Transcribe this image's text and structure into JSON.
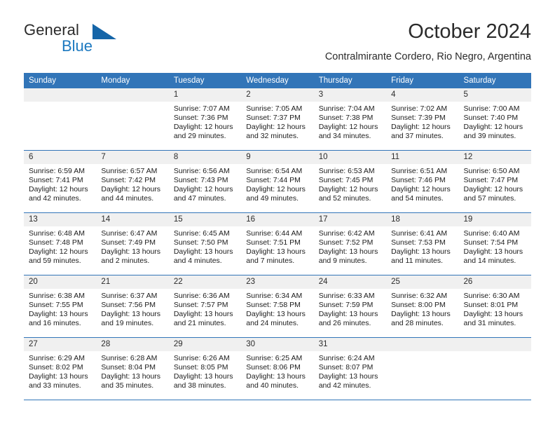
{
  "brand": {
    "name_part1": "General",
    "name_part2": "Blue",
    "logo_icon": "blue-triangle-icon"
  },
  "header": {
    "month_title": "October 2024",
    "location": "Contralmirante Cordero, Rio Negro, Argentina"
  },
  "theme": {
    "accent": "#3275b8",
    "brand_blue": "#1c79c0",
    "daynum_bg": "#f0f0f0",
    "text": "#1c1c1c"
  },
  "weekday_headers": [
    "Sunday",
    "Monday",
    "Tuesday",
    "Wednesday",
    "Thursday",
    "Friday",
    "Saturday"
  ],
  "weeks": [
    [
      {
        "day": "",
        "sunrise": "",
        "sunset": "",
        "daylight1": "",
        "daylight2": "",
        "blank": true
      },
      {
        "day": "",
        "sunrise": "",
        "sunset": "",
        "daylight1": "",
        "daylight2": "",
        "blank": true
      },
      {
        "day": "1",
        "sunrise": "Sunrise: 7:07 AM",
        "sunset": "Sunset: 7:36 PM",
        "daylight1": "Daylight: 12 hours",
        "daylight2": "and 29 minutes."
      },
      {
        "day": "2",
        "sunrise": "Sunrise: 7:05 AM",
        "sunset": "Sunset: 7:37 PM",
        "daylight1": "Daylight: 12 hours",
        "daylight2": "and 32 minutes."
      },
      {
        "day": "3",
        "sunrise": "Sunrise: 7:04 AM",
        "sunset": "Sunset: 7:38 PM",
        "daylight1": "Daylight: 12 hours",
        "daylight2": "and 34 minutes."
      },
      {
        "day": "4",
        "sunrise": "Sunrise: 7:02 AM",
        "sunset": "Sunset: 7:39 PM",
        "daylight1": "Daylight: 12 hours",
        "daylight2": "and 37 minutes."
      },
      {
        "day": "5",
        "sunrise": "Sunrise: 7:00 AM",
        "sunset": "Sunset: 7:40 PM",
        "daylight1": "Daylight: 12 hours",
        "daylight2": "and 39 minutes."
      }
    ],
    [
      {
        "day": "6",
        "sunrise": "Sunrise: 6:59 AM",
        "sunset": "Sunset: 7:41 PM",
        "daylight1": "Daylight: 12 hours",
        "daylight2": "and 42 minutes."
      },
      {
        "day": "7",
        "sunrise": "Sunrise: 6:57 AM",
        "sunset": "Sunset: 7:42 PM",
        "daylight1": "Daylight: 12 hours",
        "daylight2": "and 44 minutes."
      },
      {
        "day": "8",
        "sunrise": "Sunrise: 6:56 AM",
        "sunset": "Sunset: 7:43 PM",
        "daylight1": "Daylight: 12 hours",
        "daylight2": "and 47 minutes."
      },
      {
        "day": "9",
        "sunrise": "Sunrise: 6:54 AM",
        "sunset": "Sunset: 7:44 PM",
        "daylight1": "Daylight: 12 hours",
        "daylight2": "and 49 minutes."
      },
      {
        "day": "10",
        "sunrise": "Sunrise: 6:53 AM",
        "sunset": "Sunset: 7:45 PM",
        "daylight1": "Daylight: 12 hours",
        "daylight2": "and 52 minutes."
      },
      {
        "day": "11",
        "sunrise": "Sunrise: 6:51 AM",
        "sunset": "Sunset: 7:46 PM",
        "daylight1": "Daylight: 12 hours",
        "daylight2": "and 54 minutes."
      },
      {
        "day": "12",
        "sunrise": "Sunrise: 6:50 AM",
        "sunset": "Sunset: 7:47 PM",
        "daylight1": "Daylight: 12 hours",
        "daylight2": "and 57 minutes."
      }
    ],
    [
      {
        "day": "13",
        "sunrise": "Sunrise: 6:48 AM",
        "sunset": "Sunset: 7:48 PM",
        "daylight1": "Daylight: 12 hours",
        "daylight2": "and 59 minutes."
      },
      {
        "day": "14",
        "sunrise": "Sunrise: 6:47 AM",
        "sunset": "Sunset: 7:49 PM",
        "daylight1": "Daylight: 13 hours",
        "daylight2": "and 2 minutes."
      },
      {
        "day": "15",
        "sunrise": "Sunrise: 6:45 AM",
        "sunset": "Sunset: 7:50 PM",
        "daylight1": "Daylight: 13 hours",
        "daylight2": "and 4 minutes."
      },
      {
        "day": "16",
        "sunrise": "Sunrise: 6:44 AM",
        "sunset": "Sunset: 7:51 PM",
        "daylight1": "Daylight: 13 hours",
        "daylight2": "and 7 minutes."
      },
      {
        "day": "17",
        "sunrise": "Sunrise: 6:42 AM",
        "sunset": "Sunset: 7:52 PM",
        "daylight1": "Daylight: 13 hours",
        "daylight2": "and 9 minutes."
      },
      {
        "day": "18",
        "sunrise": "Sunrise: 6:41 AM",
        "sunset": "Sunset: 7:53 PM",
        "daylight1": "Daylight: 13 hours",
        "daylight2": "and 11 minutes."
      },
      {
        "day": "19",
        "sunrise": "Sunrise: 6:40 AM",
        "sunset": "Sunset: 7:54 PM",
        "daylight1": "Daylight: 13 hours",
        "daylight2": "and 14 minutes."
      }
    ],
    [
      {
        "day": "20",
        "sunrise": "Sunrise: 6:38 AM",
        "sunset": "Sunset: 7:55 PM",
        "daylight1": "Daylight: 13 hours",
        "daylight2": "and 16 minutes."
      },
      {
        "day": "21",
        "sunrise": "Sunrise: 6:37 AM",
        "sunset": "Sunset: 7:56 PM",
        "daylight1": "Daylight: 13 hours",
        "daylight2": "and 19 minutes."
      },
      {
        "day": "22",
        "sunrise": "Sunrise: 6:36 AM",
        "sunset": "Sunset: 7:57 PM",
        "daylight1": "Daylight: 13 hours",
        "daylight2": "and 21 minutes."
      },
      {
        "day": "23",
        "sunrise": "Sunrise: 6:34 AM",
        "sunset": "Sunset: 7:58 PM",
        "daylight1": "Daylight: 13 hours",
        "daylight2": "and 24 minutes."
      },
      {
        "day": "24",
        "sunrise": "Sunrise: 6:33 AM",
        "sunset": "Sunset: 7:59 PM",
        "daylight1": "Daylight: 13 hours",
        "daylight2": "and 26 minutes."
      },
      {
        "day": "25",
        "sunrise": "Sunrise: 6:32 AM",
        "sunset": "Sunset: 8:00 PM",
        "daylight1": "Daylight: 13 hours",
        "daylight2": "and 28 minutes."
      },
      {
        "day": "26",
        "sunrise": "Sunrise: 6:30 AM",
        "sunset": "Sunset: 8:01 PM",
        "daylight1": "Daylight: 13 hours",
        "daylight2": "and 31 minutes."
      }
    ],
    [
      {
        "day": "27",
        "sunrise": "Sunrise: 6:29 AM",
        "sunset": "Sunset: 8:02 PM",
        "daylight1": "Daylight: 13 hours",
        "daylight2": "and 33 minutes."
      },
      {
        "day": "28",
        "sunrise": "Sunrise: 6:28 AM",
        "sunset": "Sunset: 8:04 PM",
        "daylight1": "Daylight: 13 hours",
        "daylight2": "and 35 minutes."
      },
      {
        "day": "29",
        "sunrise": "Sunrise: 6:26 AM",
        "sunset": "Sunset: 8:05 PM",
        "daylight1": "Daylight: 13 hours",
        "daylight2": "and 38 minutes."
      },
      {
        "day": "30",
        "sunrise": "Sunrise: 6:25 AM",
        "sunset": "Sunset: 8:06 PM",
        "daylight1": "Daylight: 13 hours",
        "daylight2": "and 40 minutes."
      },
      {
        "day": "31",
        "sunrise": "Sunrise: 6:24 AM",
        "sunset": "Sunset: 8:07 PM",
        "daylight1": "Daylight: 13 hours",
        "daylight2": "and 42 minutes."
      },
      {
        "day": "",
        "sunrise": "",
        "sunset": "",
        "daylight1": "",
        "daylight2": "",
        "blank": true
      },
      {
        "day": "",
        "sunrise": "",
        "sunset": "",
        "daylight1": "",
        "daylight2": "",
        "blank": true
      }
    ]
  ]
}
